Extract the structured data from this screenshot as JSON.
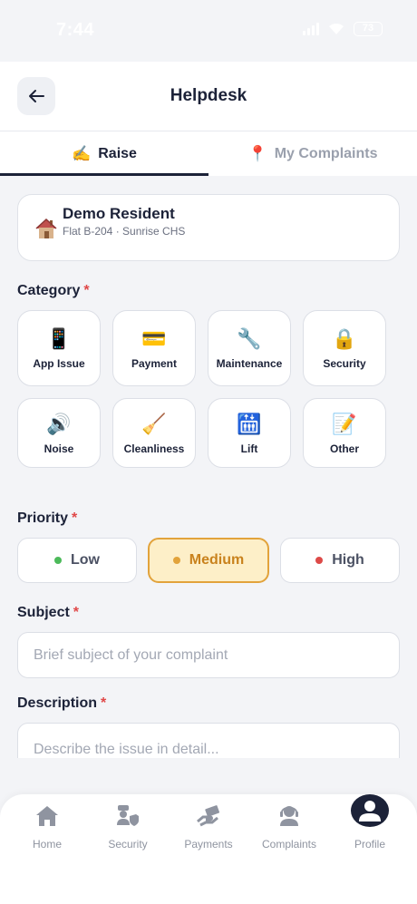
{
  "status_bar": {
    "time": "7:44",
    "battery": "73"
  },
  "header": {
    "title": "Helpdesk"
  },
  "tabs": [
    {
      "emoji": "✍️",
      "label": "Raise"
    },
    {
      "emoji": "📍",
      "label": "My Complaints"
    }
  ],
  "resident": {
    "name": "Demo Resident",
    "subtitle": "Flat B-204 · Sunrise CHS"
  },
  "category": {
    "label": "Category",
    "required": "*",
    "items": [
      {
        "emoji": "📱",
        "label": "App Issue"
      },
      {
        "emoji": "💳",
        "label": "Payment"
      },
      {
        "emoji": "🔧",
        "label": "Maintenance"
      },
      {
        "emoji": "🔒",
        "label": "Security"
      },
      {
        "emoji": "🔊",
        "label": "Noise"
      },
      {
        "emoji": "🧹",
        "label": "Cleanliness"
      },
      {
        "emoji": "🛗",
        "label": "Lift"
      },
      {
        "emoji": "📝",
        "label": "Other"
      }
    ]
  },
  "priority": {
    "label": "Priority",
    "required": "*",
    "selected": "Medium",
    "options": [
      {
        "label": "Low",
        "color": "#4cba5a"
      },
      {
        "label": "Medium",
        "color": "#e2a33b"
      },
      {
        "label": "High",
        "color": "#dd4a48"
      }
    ]
  },
  "subject": {
    "label": "Subject",
    "required": "*",
    "placeholder": "Brief subject of your complaint",
    "value": ""
  },
  "description": {
    "label": "Description",
    "required": "*",
    "placeholder": "Describe the issue in detail...",
    "value": ""
  },
  "bottom_nav": [
    {
      "label": "Home",
      "icon": "home-icon"
    },
    {
      "label": "Security",
      "icon": "security-guard-icon"
    },
    {
      "label": "Payments",
      "icon": "payments-icon"
    },
    {
      "label": "Complaints",
      "icon": "support-agent-icon"
    },
    {
      "label": "Profile",
      "icon": "profile-avatar-icon"
    }
  ],
  "colors": {
    "primary": "#1c2238",
    "accent": "#e2a33b",
    "accent_bg": "#fdefc8",
    "required": "#e04848"
  }
}
